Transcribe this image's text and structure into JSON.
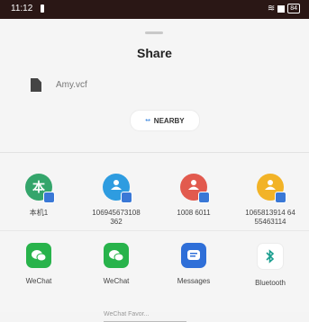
{
  "status_bar": {
    "time": "11:12",
    "battery": "84",
    "background": "#2a1715"
  },
  "sheet": {
    "title": "Share",
    "file_name": "Amy.vcf",
    "file_icon": "document-icon",
    "nearby_label": "NEARBY"
  },
  "contacts": [
    {
      "label": "本机1",
      "avatar_text": "本",
      "color": "#34a56b"
    },
    {
      "label": "106945673108\n362",
      "avatar_text": "",
      "color": "#2e9ce0"
    },
    {
      "label": "1008 6011",
      "avatar_text": "",
      "color": "#e25a4e"
    },
    {
      "label": "1065813914 64\n55463114",
      "avatar_text": "",
      "color": "#f2b327"
    }
  ],
  "apps": [
    {
      "label": "WeChat",
      "icon": "wechat-icon",
      "color": "#28b34b"
    },
    {
      "label": "WeChat",
      "icon": "wechat-icon",
      "color": "#28b34b"
    },
    {
      "label": "Messages",
      "icon": "messages-icon",
      "color": "#2f6fd8"
    },
    {
      "label": "Bluetooth",
      "icon": "bluetooth-icon",
      "color": "#ffffff"
    }
  ],
  "app_sublabel": "WeChat Favor..."
}
